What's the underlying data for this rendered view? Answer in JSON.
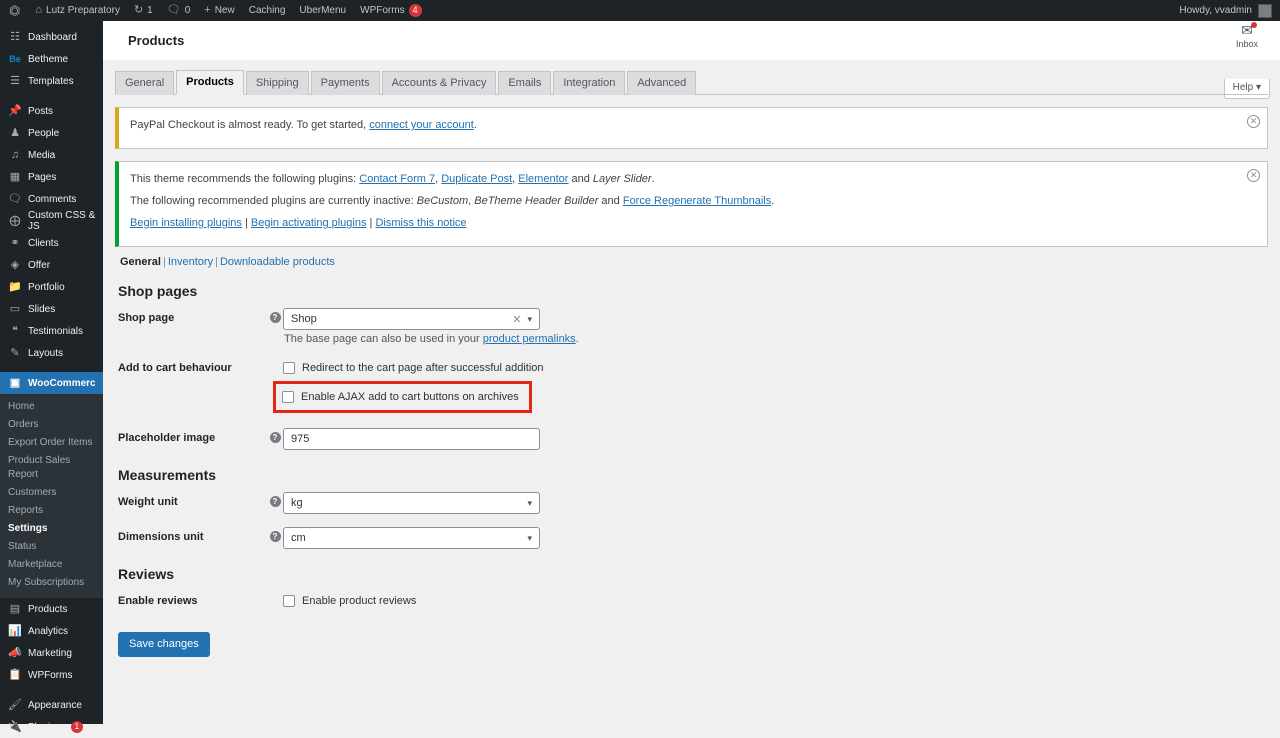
{
  "adminbar": {
    "logo_icon": "wordpress-icon",
    "site_name": "Lutz Preparatory",
    "updates_icon": "updates-icon",
    "updates_count": "1",
    "comments_icon": "comments-icon",
    "comments_count": "0",
    "new_icon": "plus-icon",
    "new_label": "New",
    "caching_label": "Caching",
    "ubermenu_label": "UberMenu",
    "wpforms_label": "WPForms",
    "wpforms_badge": "4",
    "howdy": "Howdy, vvadmin"
  },
  "sidebar": {
    "items": [
      {
        "label": "Dashboard",
        "icon": "dashboard-icon",
        "glyph": "☲",
        "current": false
      },
      {
        "label": "Betheme",
        "icon": "betheme-icon",
        "glyph": "Be",
        "current": false
      },
      {
        "label": "Templates",
        "icon": "templates-icon",
        "glyph": "☰",
        "current": false
      },
      {
        "label": "Posts",
        "icon": "pin-icon",
        "glyph": "✐",
        "current": false
      },
      {
        "label": "People",
        "icon": "people-icon",
        "glyph": "♟",
        "current": false
      },
      {
        "label": "Media",
        "icon": "media-icon",
        "glyph": "♫",
        "current": false
      },
      {
        "label": "Pages",
        "icon": "pages-icon",
        "glyph": "☷",
        "current": false
      },
      {
        "label": "Comments",
        "icon": "comments-icon",
        "glyph": "⬛",
        "current": false
      },
      {
        "label": "Custom CSS & JS",
        "icon": "plus-circle-icon",
        "glyph": "⊕",
        "current": false
      },
      {
        "label": "Clients",
        "icon": "clients-icon",
        "glyph": "⛭",
        "current": false
      },
      {
        "label": "Offer",
        "icon": "offer-icon",
        "glyph": "◈",
        "current": false
      },
      {
        "label": "Portfolio",
        "icon": "portfolio-icon",
        "glyph": "☷",
        "current": false
      },
      {
        "label": "Slides",
        "icon": "slides-icon",
        "glyph": "▭",
        "current": false
      },
      {
        "label": "Testimonials",
        "icon": "quote-icon",
        "glyph": "“",
        "current": false
      },
      {
        "label": "Layouts",
        "icon": "pencil-icon",
        "glyph": "✎",
        "current": false
      },
      {
        "label": "WooCommerce",
        "icon": "woocommerce-icon",
        "glyph": "▣",
        "current": true
      }
    ],
    "submenu": [
      {
        "label": "Home",
        "current": false
      },
      {
        "label": "Orders",
        "current": false
      },
      {
        "label": "Export Order Items",
        "current": false
      },
      {
        "label": "Product Sales Report",
        "current": false
      },
      {
        "label": "Customers",
        "current": false
      },
      {
        "label": "Reports",
        "current": false
      },
      {
        "label": "Settings",
        "current": true
      },
      {
        "label": "Status",
        "current": false
      },
      {
        "label": "Marketplace",
        "current": false
      },
      {
        "label": "My Subscriptions",
        "current": false
      }
    ],
    "items_after": [
      {
        "label": "Products",
        "icon": "products-icon",
        "glyph": "▤",
        "badge": ""
      },
      {
        "label": "Analytics",
        "icon": "analytics-icon",
        "glyph": "█",
        "badge": ""
      },
      {
        "label": "Marketing",
        "icon": "megaphone-icon",
        "glyph": "⌗",
        "badge": ""
      },
      {
        "label": "WPForms",
        "icon": "wpforms-icon",
        "glyph": "⌸",
        "badge": ""
      }
    ],
    "items_tail": [
      {
        "label": "Appearance",
        "icon": "brush-icon",
        "glyph": "✐",
        "badge": ""
      },
      {
        "label": "Plugins",
        "icon": "plug-icon",
        "glyph": "⚙",
        "badge": "1"
      }
    ]
  },
  "header": {
    "page_title": "Products",
    "inbox_label": "Inbox",
    "inbox_icon": "inbox-icon",
    "help_label": "Help",
    "help_caret": "▾"
  },
  "tabs": [
    {
      "label": "General",
      "active": false
    },
    {
      "label": "Products",
      "active": true
    },
    {
      "label": "Shipping",
      "active": false
    },
    {
      "label": "Payments",
      "active": false
    },
    {
      "label": "Accounts & Privacy",
      "active": false
    },
    {
      "label": "Emails",
      "active": false
    },
    {
      "label": "Integration",
      "active": false
    },
    {
      "label": "Advanced",
      "active": false
    }
  ],
  "notices": {
    "paypal": {
      "text_before": "PayPal Checkout is almost ready. To get started, ",
      "link": "connect your account",
      "text_after": ".",
      "dismiss_icon": "close-icon"
    },
    "plugins": {
      "line1_before": "This theme recommends the following plugins: ",
      "line1_links": [
        "Contact Form 7",
        "Duplicate Post",
        "Elementor"
      ],
      "line1_and": " and ",
      "line1_plain": "Layer Slider",
      "line1_end": ".",
      "line2_before": "The following recommended plugins are currently inactive: ",
      "line2_plain1": "BeCustom",
      "line2_plain2": "BeTheme Header Builder",
      "line2_and": " and ",
      "line2_link": "Force Regenerate Thumbnails",
      "line2_end": ".",
      "action1": "Begin installing plugins",
      "action2": "Begin activating plugins",
      "action3": "Dismiss this notice",
      "dismiss_icon": "close-icon"
    }
  },
  "subnav": [
    {
      "label": "General",
      "current": true
    },
    {
      "label": "Inventory",
      "current": false
    },
    {
      "label": "Downloadable products",
      "current": false
    }
  ],
  "sections": {
    "shop_pages": {
      "title": "Shop pages",
      "shop_page": {
        "label": "Shop page",
        "value": "Shop",
        "clear_icon": "clear-icon",
        "caret_icon": "chevron-down-icon",
        "help_icon": "help-icon",
        "desc_before": "The base page can also be used in your ",
        "desc_link": "product permalinks",
        "desc_after": "."
      },
      "add_to_cart": {
        "label": "Add to cart behaviour",
        "option1": "Redirect to the cart page after successful addition",
        "option1_checked": false,
        "option2": "Enable AJAX add to cart buttons on archives",
        "option2_checked": false,
        "option2_highlighted": true,
        "highlight_color": "#e22718"
      },
      "placeholder_image": {
        "label": "Placeholder image",
        "value": "975",
        "help_icon": "help-icon"
      }
    },
    "measurements": {
      "title": "Measurements",
      "weight_unit": {
        "label": "Weight unit",
        "value": "kg",
        "help_icon": "help-icon",
        "caret_icon": "chevron-down-icon"
      },
      "dimensions_unit": {
        "label": "Dimensions unit",
        "value": "cm",
        "help_icon": "help-icon",
        "caret_icon": "chevron-down-icon"
      }
    },
    "reviews": {
      "title": "Reviews",
      "enable_reviews": {
        "label": "Enable reviews",
        "option": "Enable product reviews",
        "checked": false
      }
    }
  },
  "save_button": "Save changes",
  "colors": {
    "accent": "#2271b1",
    "highlight": "#e22718",
    "notice_warn": "#dba617",
    "notice_info": "#00a32a",
    "badge": "#d63638"
  }
}
